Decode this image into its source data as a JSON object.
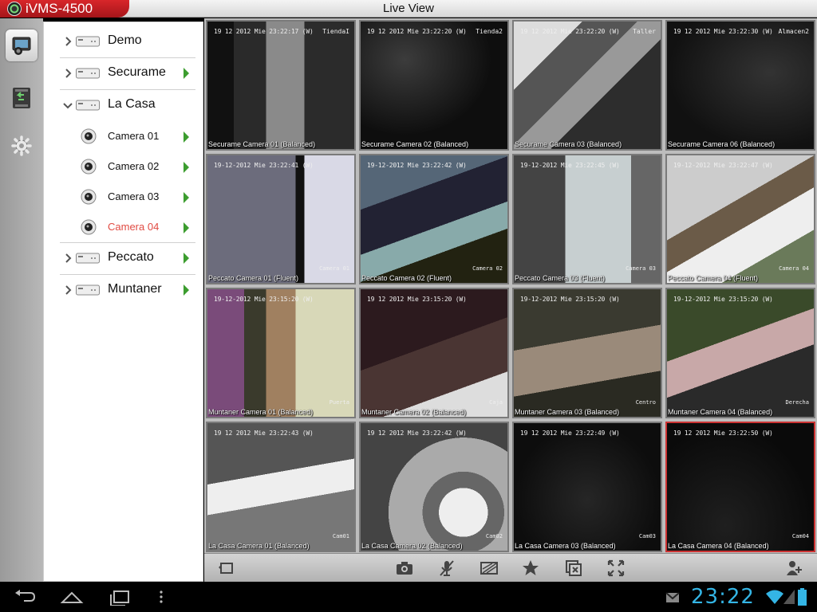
{
  "app": {
    "brand": "iVMS-4500",
    "title": "Live View"
  },
  "rail": [
    {
      "name": "live-view-icon",
      "active": true
    },
    {
      "name": "playback-icon",
      "active": false
    },
    {
      "name": "settings-icon",
      "active": false
    }
  ],
  "tree": {
    "devices": [
      {
        "label": "Demo",
        "expanded": false,
        "play": false
      },
      {
        "label": "Securame",
        "expanded": false,
        "play": true
      },
      {
        "label": "La Casa",
        "expanded": true,
        "play": false,
        "cameras": [
          {
            "label": "Camera 01",
            "selected": false
          },
          {
            "label": "Camera 02",
            "selected": false
          },
          {
            "label": "Camera 03",
            "selected": false
          },
          {
            "label": "Camera 04",
            "selected": true
          }
        ]
      },
      {
        "label": "Peccato",
        "expanded": false,
        "play": true
      },
      {
        "label": "Muntaner",
        "expanded": false,
        "play": true
      }
    ]
  },
  "feeds": [
    {
      "caption": "Securame Camera 01 (Balanced)",
      "ts": "19 12 2012 Mie 23:22:17 (W)",
      "loc": "TiendaI",
      "locb": "",
      "scene": "door",
      "selected": false
    },
    {
      "caption": "Securame Camera 02 (Balanced)",
      "ts": "19 12 2012 Mie 23:22:20 (W)",
      "loc": "Tienda2",
      "locb": "",
      "scene": "dark-room",
      "selected": false
    },
    {
      "caption": "Securame Camera 03 (Balanced)",
      "ts": "19 12 2012 Mie 23:22:20 (W)",
      "loc": "Taller",
      "locb": "",
      "scene": "stairs",
      "selected": false
    },
    {
      "caption": "Securame Camera 06 (Balanced)",
      "ts": "19 12 2012 Mie 23:22:30 (W)",
      "loc": "Almacen2",
      "locb": "",
      "scene": "night",
      "selected": false
    },
    {
      "caption": "Peccato Camera 01 (Fluent)",
      "ts": "19-12-2012 Mie 23:22:41 (W)",
      "loc": "",
      "locb": "Camera 01",
      "scene": "bright",
      "selected": false
    },
    {
      "caption": "Peccato Camera 02 (Fluent)",
      "ts": "19-12-2012 Mie 23:22:42 (W)",
      "loc": "",
      "locb": "Camera 02",
      "scene": "kitchen",
      "selected": false
    },
    {
      "caption": "Peccato Camera 03 (Fluent)",
      "ts": "19-12-2012 Mie 23:22:45 (W)",
      "loc": "",
      "locb": "Camera 03",
      "scene": "fridge",
      "selected": false
    },
    {
      "caption": "Peccato Camera 04 (Fluent)",
      "ts": "19-12-2012 Mie 23:22:47 (W)",
      "loc": "",
      "locb": "Camera 04",
      "scene": "kitchen2",
      "selected": false
    },
    {
      "caption": "Muntaner Camera 01 (Balanced)",
      "ts": "19-12-2012 Mie 23:15:20 (W)",
      "loc": "",
      "locb": "Puerta",
      "scene": "shop",
      "selected": false
    },
    {
      "caption": "Muntaner Camera 02 (Balanced)",
      "ts": "19 12 2012 Mie 23:15:20 (W)",
      "loc": "",
      "locb": "Caja",
      "scene": "restaurant",
      "selected": false
    },
    {
      "caption": "Muntaner Camera 03 (Balanced)",
      "ts": "19-12-2012 Mie 23:15:20 (W)",
      "loc": "",
      "locb": "Centro",
      "scene": "bar",
      "selected": false
    },
    {
      "caption": "Muntaner Camera 04 (Balanced)",
      "ts": "19-12-2012 Mie 23:15:20 (W)",
      "loc": "",
      "locb": "Derecha",
      "scene": "terrace",
      "selected": false
    },
    {
      "caption": "La Casa Camera 01 (Balanced)",
      "ts": "19 12 2012 Mie 23:22:43 (W)",
      "loc": "",
      "locb": "Cam01",
      "scene": "office",
      "selected": false
    },
    {
      "caption": "La Casa Camera 02 (Balanced)",
      "ts": "19 12 2012 Mie 23:22:42 (W)",
      "loc": "",
      "locb": "Cam02",
      "scene": "spiral",
      "selected": false
    },
    {
      "caption": "La Casa Camera 03 (Balanced)",
      "ts": "19 12 2012 Mie 23:22:49 (W)",
      "loc": "",
      "locb": "Cam03",
      "scene": "very-dark",
      "selected": false
    },
    {
      "caption": "La Casa Camera 04 (Balanced)",
      "ts": "19 12 2012 Mie 23:22:50 (W)",
      "loc": "",
      "locb": "Cam04",
      "scene": "very-dark2",
      "selected": true
    }
  ],
  "toolbar": [
    "layout-icon",
    "snapshot-icon",
    "audio-mute-icon",
    "quality-icon",
    "favorite-icon",
    "close-all-icon",
    "fullscreen-icon",
    "ptz-icon"
  ],
  "statusbar": {
    "clock": "23:22"
  }
}
